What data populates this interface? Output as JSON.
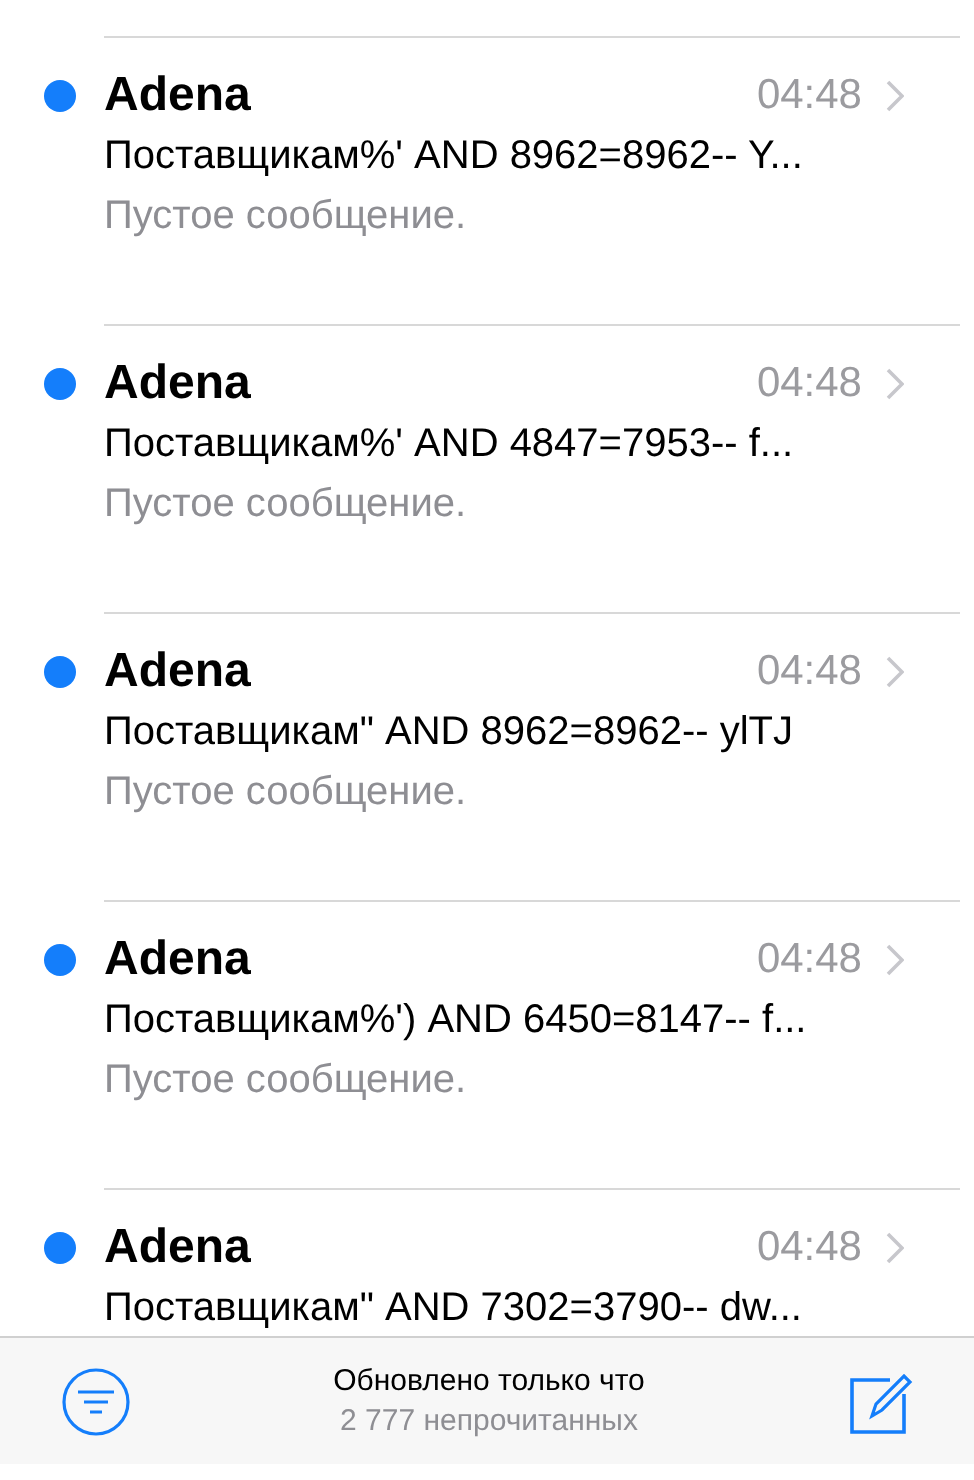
{
  "messages": [
    {
      "sender": "Adena",
      "time": "04:48",
      "subject": "Поставщикам%' AND 8962=8962-- Y...",
      "preview": "Пустое сообщение.",
      "unread": true
    },
    {
      "sender": "Adena",
      "time": "04:48",
      "subject": "Поставщикам%' AND 4847=7953-- f...",
      "preview": "Пустое сообщение.",
      "unread": true
    },
    {
      "sender": "Adena",
      "time": "04:48",
      "subject": "Поставщикам\" AND 8962=8962-- ylTJ",
      "preview": "Пустое сообщение.",
      "unread": true
    },
    {
      "sender": "Adena",
      "time": "04:48",
      "subject": "Поставщикам%') AND 6450=8147-- f...",
      "preview": "Пустое сообщение.",
      "unread": true
    },
    {
      "sender": "Adena",
      "time": "04:48",
      "subject": "Поставщикам\" AND 7302=3790-- dw...",
      "unread": true
    }
  ],
  "toolbar": {
    "status": "Обновлено только что",
    "unread_count": "2 777 непрочитанных"
  }
}
